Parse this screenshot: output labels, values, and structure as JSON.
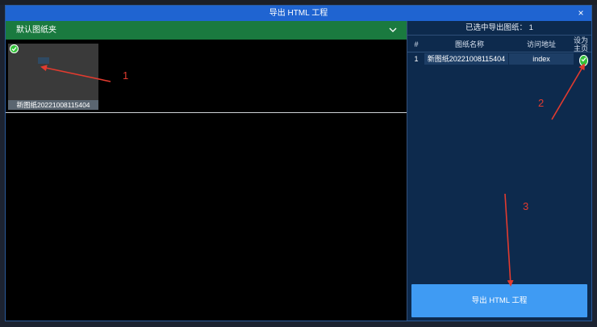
{
  "dialog": {
    "title": "导出 HTML 工程",
    "close_glyph": "×"
  },
  "folder": {
    "name": "默认图纸夹",
    "expanded": true
  },
  "thumbnail": {
    "label": "新图纸20221008115404",
    "selected": true
  },
  "selection": {
    "label": "已选中导出图纸：",
    "count": "1"
  },
  "table": {
    "headers": {
      "index": "#",
      "name": "图纸名称",
      "address": "访问地址",
      "homepage_line1": "设为",
      "homepage_line2": "主页"
    },
    "rows": [
      {
        "index": "1",
        "name": "新图纸20221008115404",
        "address": "index",
        "is_homepage": true
      }
    ]
  },
  "export_button": {
    "label": "导出 HTML 工程"
  },
  "annotations": {
    "step1": "1",
    "step2": "2",
    "step3": "3"
  },
  "colors": {
    "accent": "#1f64d1",
    "folder_bar": "#1a7a3f",
    "export_button": "#3f9bf3",
    "check": "#34c23a",
    "annotation": "#e23b2f"
  }
}
